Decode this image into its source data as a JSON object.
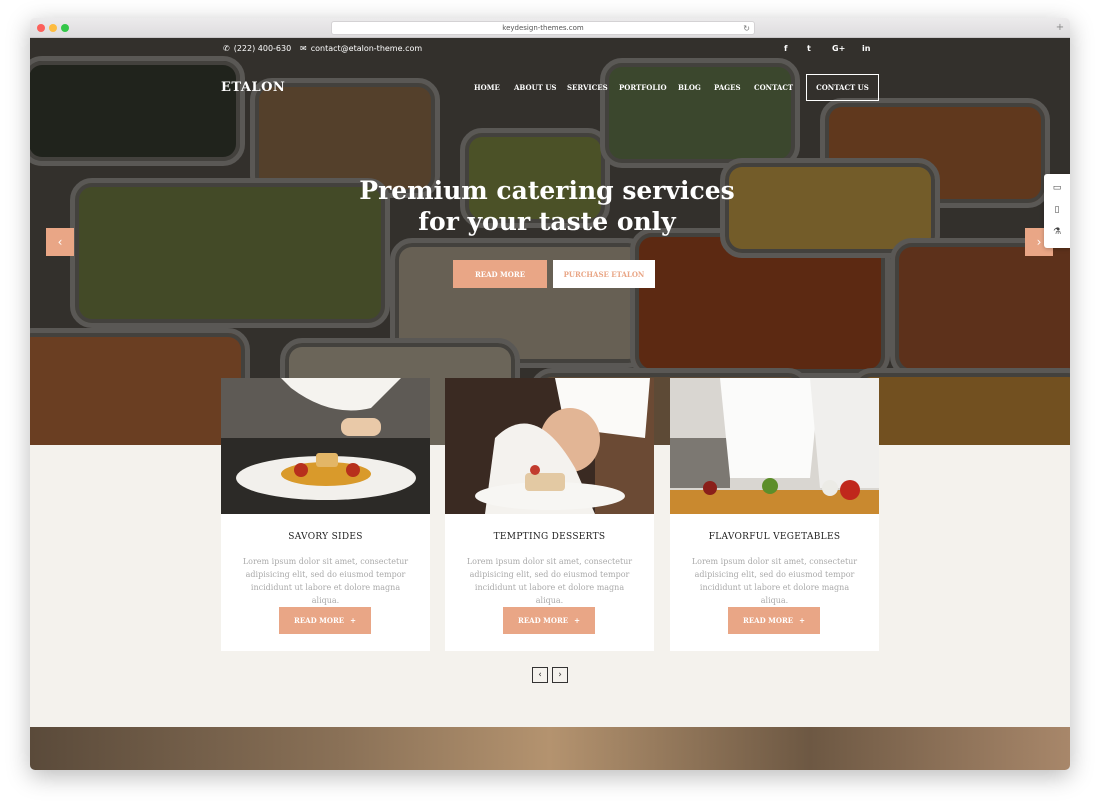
{
  "browser": {
    "url": "keydesign-themes.com",
    "reload_icon": "reload-icon",
    "new_tab_icon": "plus-icon"
  },
  "topbar": {
    "phone": "(222) 400-630",
    "email": "contact@etalon-theme.com",
    "social": [
      "f",
      "t",
      "G+",
      "in"
    ]
  },
  "header": {
    "logo": "ETALON",
    "nav": [
      "HOME",
      "ABOUT US",
      "SERVICES",
      "PORTFOLIO",
      "BLOG",
      "PAGES",
      "CONTACT"
    ],
    "cta": "CONTACT US"
  },
  "hero": {
    "title_line1": "Premium catering services",
    "title_line2": "for your taste only",
    "btn_primary": "READ MORE",
    "btn_secondary": "PURCHASE ETALON",
    "prev_arrow": "‹",
    "next_arrow": "›"
  },
  "side_tools": [
    "desktop-icon",
    "tablet-icon",
    "flask-icon"
  ],
  "cards": [
    {
      "title": "SAVORY SIDES",
      "text": "Lorem ipsum dolor sit amet, consectetur adipisicing elit, sed do eiusmod tempor incididunt ut labore et dolore magna aliqua.",
      "btn": "READ MORE"
    },
    {
      "title": "TEMPTING DESSERTS",
      "text": "Lorem ipsum dolor sit amet, consectetur adipisicing elit, sed do eiusmod tempor incididunt ut labore et dolore magna aliqua.",
      "btn": "READ MORE"
    },
    {
      "title": "FLAVORFUL VEGETABLES",
      "text": "Lorem ipsum dolor sit amet, consectetur adipisicing elit, sed do eiusmod tempor incididunt ut labore et dolore magna aliqua.",
      "btn": "READ MORE"
    }
  ],
  "pager": {
    "prev": "‹",
    "next": "›"
  },
  "colors": {
    "accent": "#e9a686",
    "background": "#f4f2ed"
  }
}
